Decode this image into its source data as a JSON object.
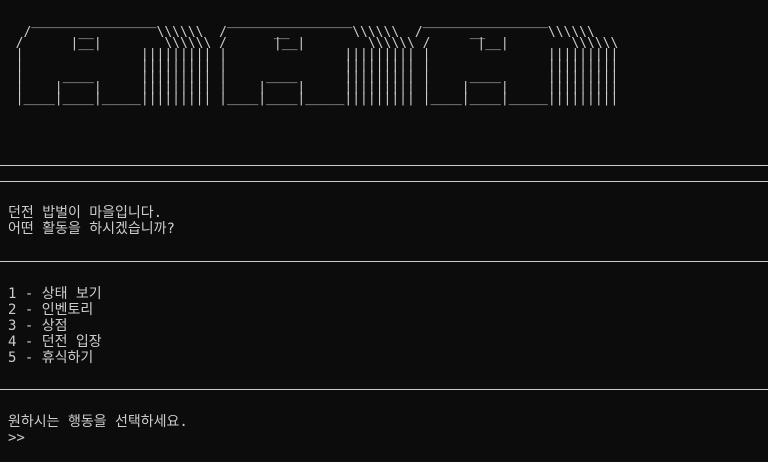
{
  "village_art": [
    "    ________________         ________________         ________________",
    "   /      __        \\\\\\\\\\\\  /      __        \\\\\\\\\\\\  /      __        \\\\\\\\\\\\",
    "  /      |__|        \\\\\\\\\\\\ /      |__|        \\\\\\\\\\\\ /      |__|        \\\\\\\\\\\\",
    "  |               ||||||||| |               ||||||||| |               |||||||||",
    "  |               ||||||||| |               ||||||||| |               |||||||||",
    "  |     ____      ||||||||| |     ____      ||||||||| |     ____      |||||||||",
    "  |    |    |     ||||||||| |    |    |     ||||||||| |    |    |     |||||||||",
    "  |____|____|_____||||||||| |____|____|_____||||||||| |____|____|_____|||||||||"
  ],
  "intro": {
    "line1": "던전 밥벌이 마을입니다.",
    "line2": "어떤 활동을 하시겠습니까?"
  },
  "menu": [
    "1 - 상태 보기",
    "2 - 인벤토리",
    "3 - 상점",
    "4 - 던전 입장",
    "5 - 휴식하기"
  ],
  "footer": {
    "instruction": "원하시는 행동을 선택하세요.",
    "prompt": ">>",
    "input_value": ""
  }
}
